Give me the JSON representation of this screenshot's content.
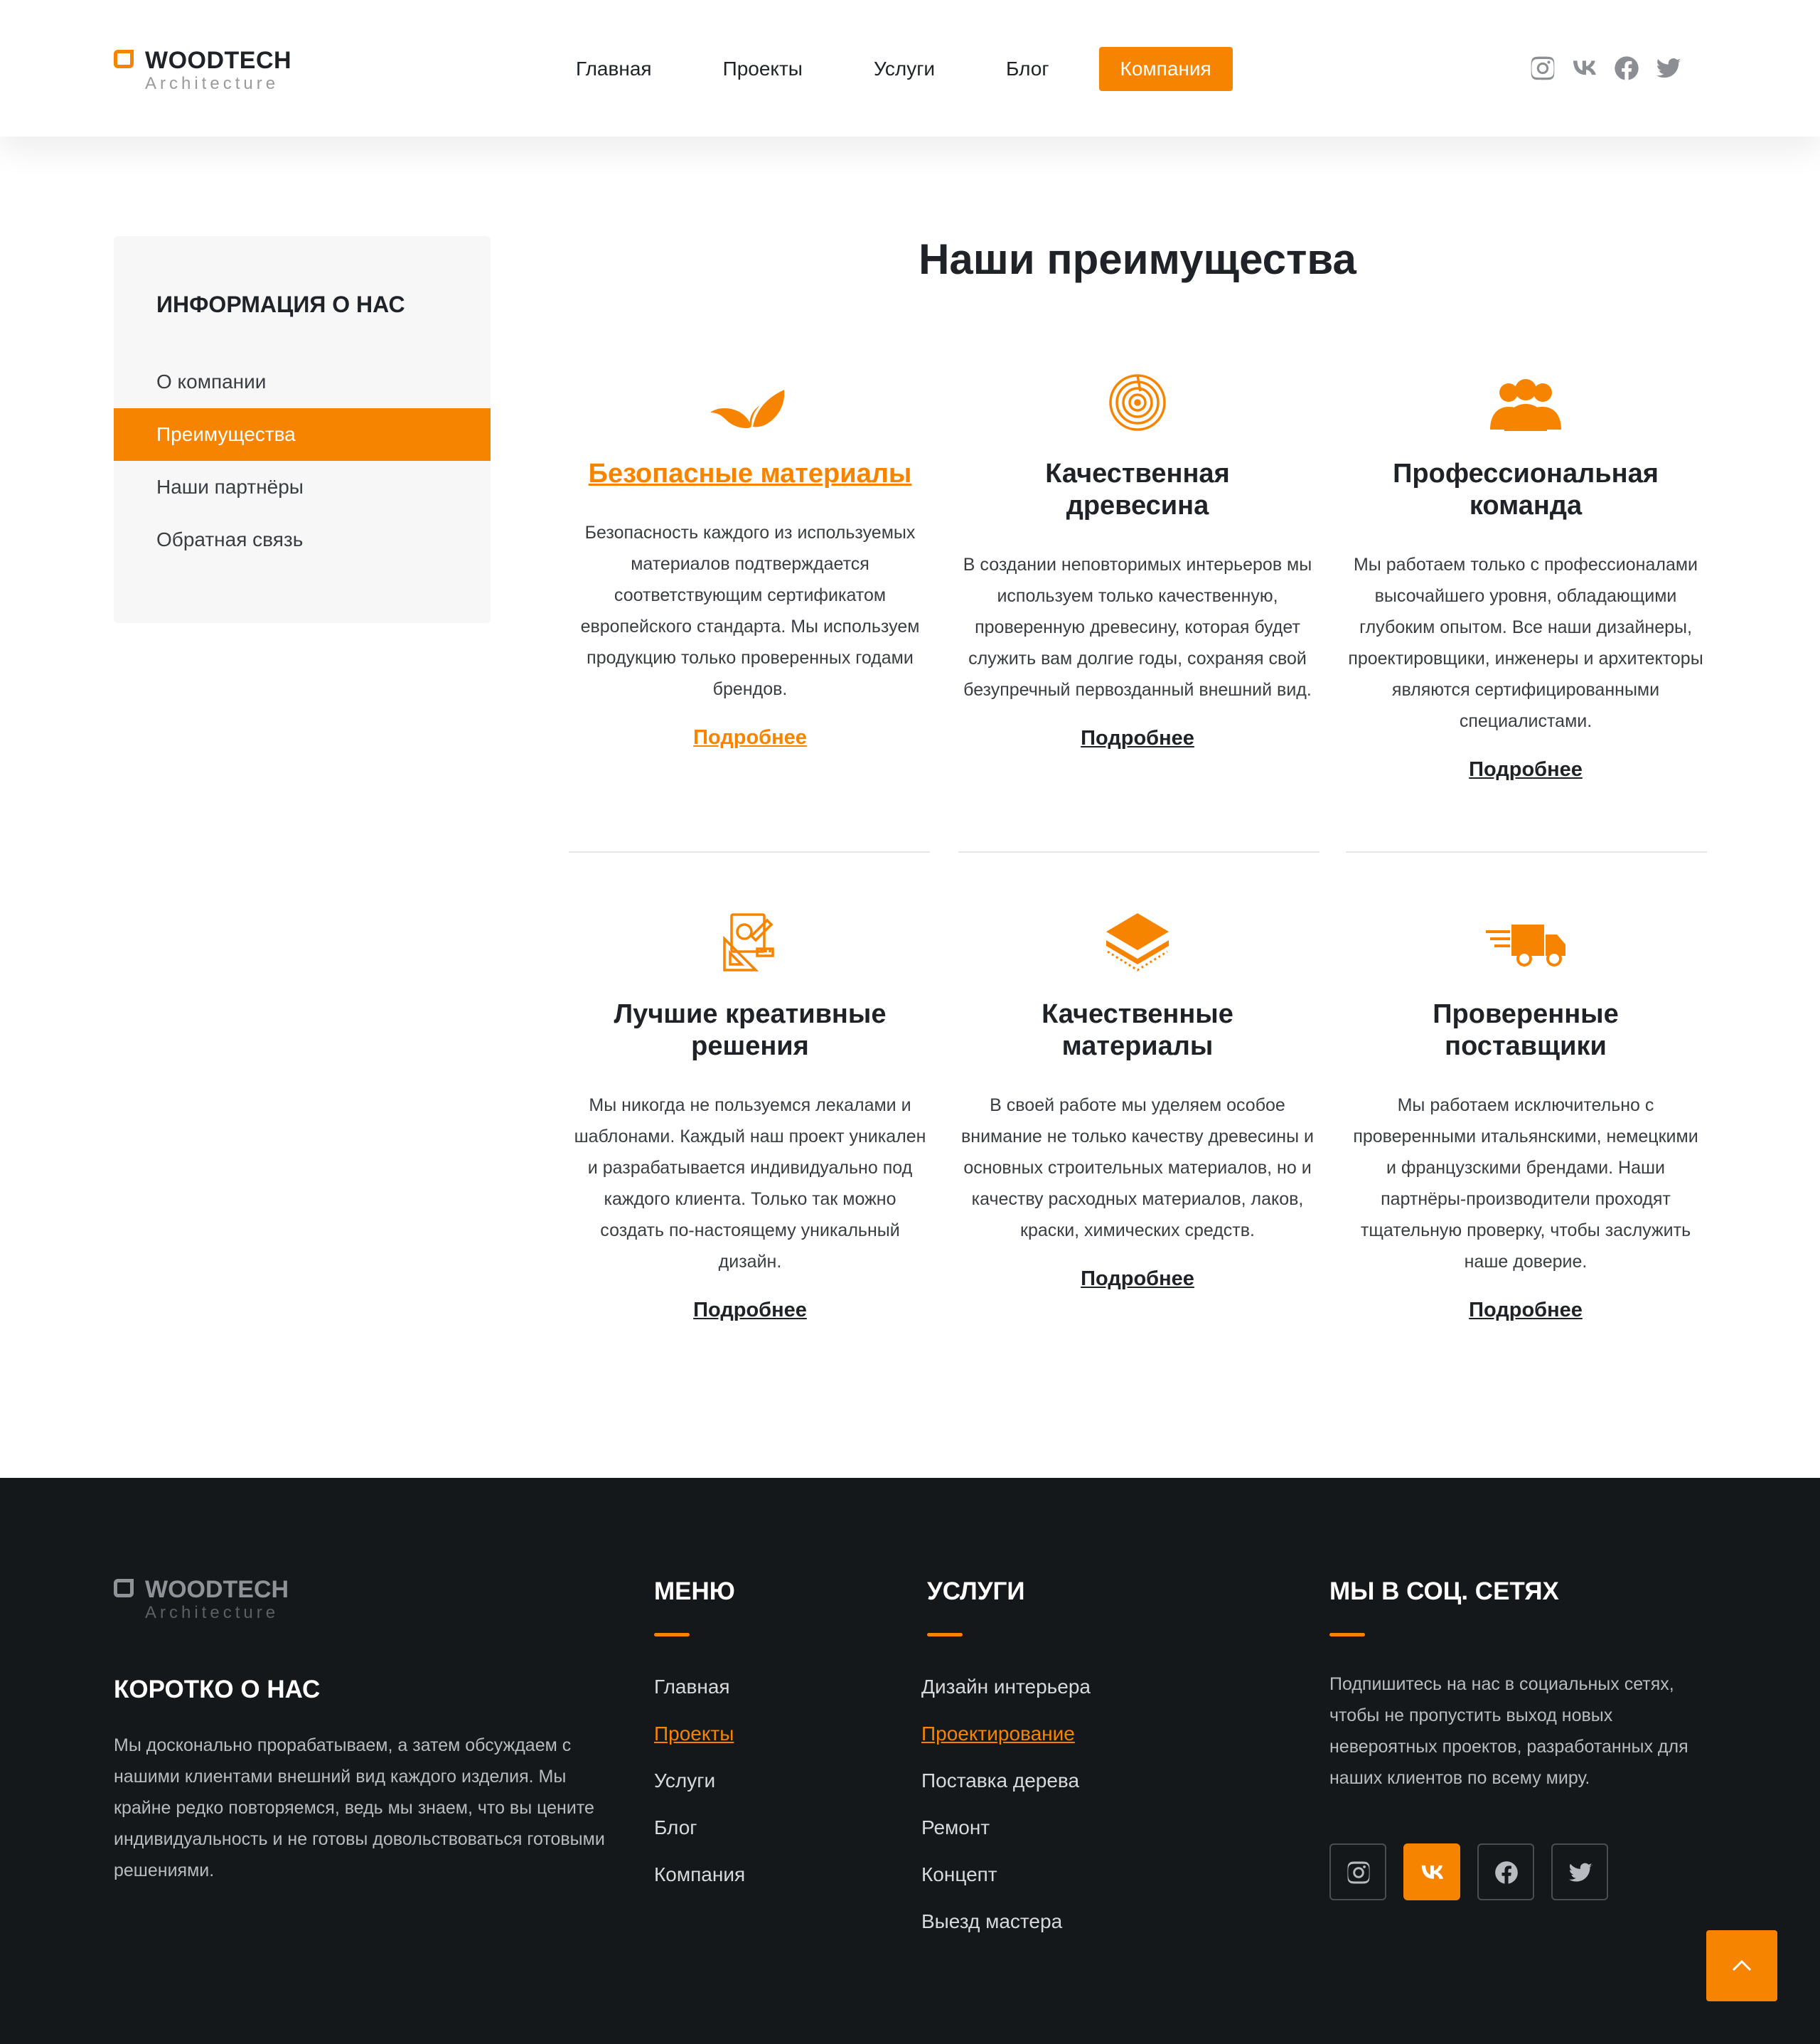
{
  "brand": {
    "name": "WOODTECH",
    "tagline": "Architecture"
  },
  "nav": {
    "items": [
      "Главная",
      "Проекты",
      "Услуги",
      "Блог",
      "Компания"
    ],
    "active_index": 4
  },
  "header_socials": [
    "instagram-icon",
    "vk-icon",
    "facebook-icon",
    "twitter-icon"
  ],
  "sidebar": {
    "title": "ИНФОРМАЦИЯ О НАС",
    "items": [
      "О компании",
      "Преимущества",
      "Наши партнёры",
      "Обратная связь"
    ],
    "active_index": 1
  },
  "main": {
    "title": "Наши преимущества",
    "cards": [
      {
        "icon": "leaf-icon",
        "title": "Безопасные материалы",
        "text": "Безопасность каждого из используемых материалов подтверждается соответствующим сертификатом европейского стандарта. Мы используем продукцию только проверенных годами брендов.",
        "link": "Подробнее"
      },
      {
        "icon": "tree-rings-icon",
        "title": "Качественная древесина",
        "text": "В создании неповторимых интерьеров мы используем только качественную, проверенную древесину, которая будет служить вам долгие годы, сохраняя свой безупречный первозданный внешний вид.",
        "link": "Подробнее"
      },
      {
        "icon": "team-icon",
        "title": "Профессиональная команда",
        "text": "Мы работаем только с профессионалами высочайшего уровня, обладающими глубоким опытом. Все наши дизайнеры, проектировщики, инженеры и архитекторы являются сертифицированными специалистами.",
        "link": "Подробнее"
      },
      {
        "icon": "design-tools-icon",
        "title": "Лучшие креативные решения",
        "text": "Мы никогда не пользуемся лекалами и шаблонами. Каждый наш проект уникален и разрабатывается индивидуально под каждого клиента. Только так можно создать по-настоящему уникальный дизайн.",
        "link": "Подробнее"
      },
      {
        "icon": "layers-icon",
        "title": "Качественные материалы",
        "text": "В своей работе мы уделяем особое внимание не только качеству древесины и основных строительных материалов, но и качеству расходных материалов, лаков, краски, химических средств.",
        "link": "Подробнее"
      },
      {
        "icon": "delivery-truck-icon",
        "title": "Проверенные поставщики",
        "text": "Мы работаем исключительно с проверенными итальянскими, немецкими и французскими брендами. Наши партнёры-производители проходят тщательную проверку, чтобы заслужить наше доверие.",
        "link": "Подробнее"
      }
    ]
  },
  "footer": {
    "about_title": "КОРОТКО О НАС",
    "about_text": "Мы досконально прорабатываем, а затем обсуждаем с нашими клиентами внешний вид каждого изделия. Мы крайне редко повторяемся, ведь мы знаем, что вы цените индивидуальность и не готовы довольствоваться готовыми решениями.",
    "menu_title": "МЕНЮ",
    "menu_items": [
      "Главная",
      "Проекты",
      "Услуги",
      "Блог",
      "Компания"
    ],
    "menu_active_index": 1,
    "services_title": "УСЛУГИ",
    "services_items": [
      "Дизайн интерьера",
      "Проектирование",
      "Поставка дерева",
      "Ремонт",
      "Концепт",
      "Выезд мастера"
    ],
    "services_active_index": 1,
    "social_title": "МЫ В СОЦ. СЕТЯХ",
    "social_text": "Подпишитесь на нас в социальных сетях, чтобы не пропустить выход новых невероятных проектов, разработанных для наших клиентов по всему миру.",
    "social_icons": [
      "instagram-icon",
      "vk-icon",
      "facebook-icon",
      "twitter-icon"
    ],
    "social_active_index": 1
  },
  "colors": {
    "accent": "#f78400",
    "dark": "#15181a",
    "text": "#1f2327"
  }
}
